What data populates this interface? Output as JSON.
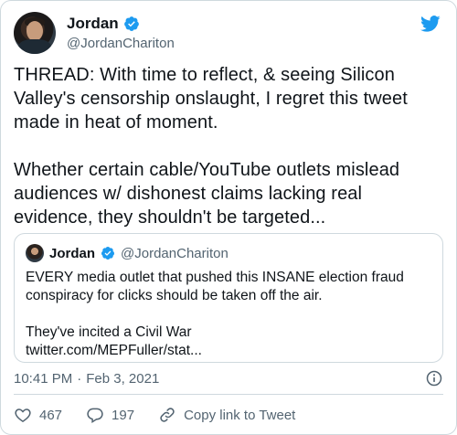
{
  "author": {
    "display_name": "Jordan",
    "handle": "@JordanChariton",
    "verified": true
  },
  "tweet": {
    "paragraphs": [
      "THREAD: With time to reflect, & seeing Silicon Valley's censorship onslaught, I regret this tweet made in heat of moment.",
      "Whether certain cable/YouTube outlets mislead audiences w/ dishonest claims lacking real evidence, they shouldn't be targeted..."
    ]
  },
  "quoted_tweet": {
    "display_name": "Jordan",
    "handle": "@JordanChariton",
    "verified": true,
    "text_lines": [
      "EVERY media outlet that pushed this INSANE election fraud conspiracy for clicks should be taken off the air.",
      "They've incited a Civil War",
      "twitter.com/MEPFuller/stat..."
    ]
  },
  "meta": {
    "time": "10:41 PM",
    "separator": "·",
    "date": "Feb 3, 2021"
  },
  "actions": {
    "likes": "467",
    "replies": "197",
    "copy_link_label": "Copy link to Tweet"
  },
  "icons": {
    "brand": "twitter-bird-icon",
    "verified": "verified-badge-icon",
    "info": "info-icon",
    "like": "heart-icon",
    "reply": "reply-icon",
    "copy": "link-icon"
  },
  "colors": {
    "brand_blue": "#1d9bf0",
    "secondary_text": "#536471",
    "border": "#cfd9de"
  }
}
